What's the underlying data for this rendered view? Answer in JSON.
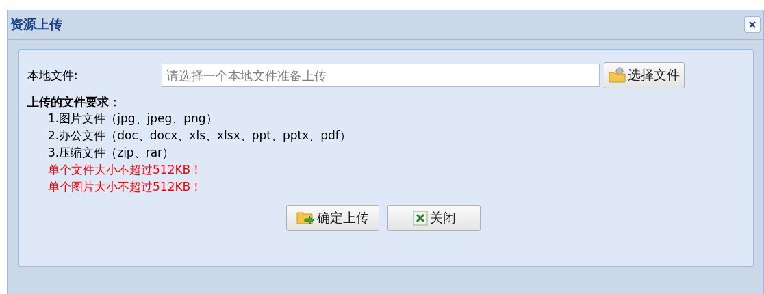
{
  "window": {
    "title": "资源上传"
  },
  "file_field": {
    "label": "本地文件:",
    "placeholder": "请选择一个本地文件准备上传",
    "button": "选择文件"
  },
  "requirements": {
    "heading": "上传的文件要求：",
    "lines": [
      {
        "kind": "item",
        "text": "1.图片文件（jpg、jpeg、png）"
      },
      {
        "kind": "item",
        "text": "2.办公文件（doc、docx、xls、xlsx、ppt、pptx、pdf）"
      },
      {
        "kind": "item",
        "text": "3.压缩文件（zip、rar）"
      },
      {
        "kind": "warning",
        "text": "单个文件大小不超过512KB！"
      },
      {
        "kind": "warning",
        "text": "单个图片大小不超过512KB！"
      }
    ]
  },
  "buttons": [
    {
      "kind": "upload",
      "label": "确定上传"
    },
    {
      "kind": "close",
      "label": "关闭"
    }
  ]
}
